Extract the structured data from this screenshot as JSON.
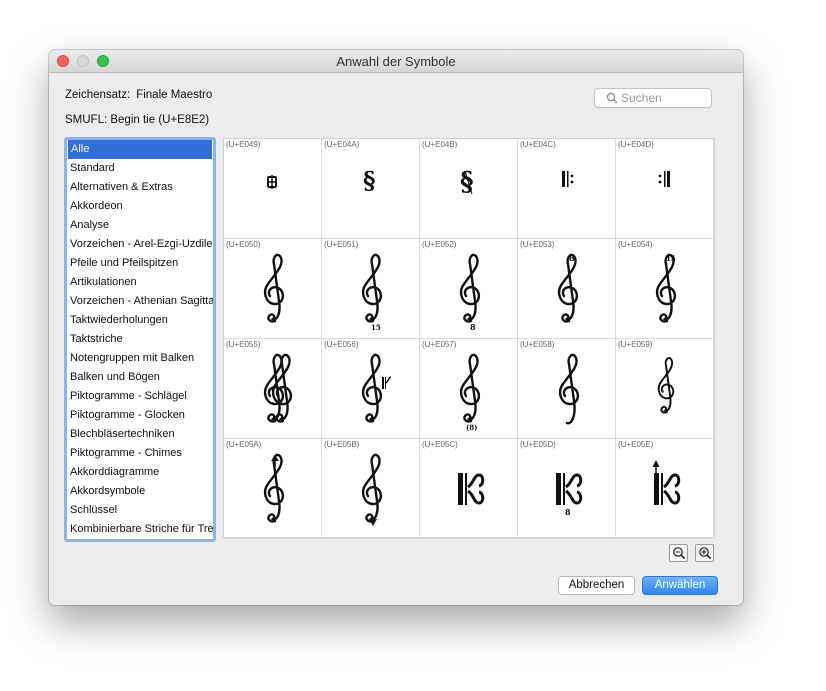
{
  "window": {
    "title": "Anwahl der Symbole"
  },
  "font": {
    "label": "Zeichensatz:",
    "value": "Finale Maestro"
  },
  "smufl_label": "SMUFL: Begin tie (U+E8E2)",
  "search": {
    "placeholder": "Suchen",
    "value": ""
  },
  "categories": [
    "Alle",
    "Standard",
    "Alternativen & Extras",
    "Akkordeon",
    "Analyse",
    "Vorzeichen - Arel-Ezgi-Uzdilek",
    "Pfeile und Pfeilspitzen",
    "Artikulationen",
    "Vorzeichen - Athenian Sagittal",
    "Taktwiederholungen",
    "Taktstriche",
    "Notengruppen mit Balken",
    "Balken und Bögen",
    "Piktogramme - Schlägel",
    "Piktogramme - Glocken",
    "Blechbläsertechniken",
    "Piktogramme - Chimes",
    "Akkorddiagramme",
    "Akkordsymbole",
    "Schlüssel",
    "Kombinierbare Striche für Tremolo"
  ],
  "selected_category": "Alle",
  "symbols": [
    {
      "code": "(U+E049)",
      "icon": "segno-variant-icon"
    },
    {
      "code": "(U+E04A)",
      "icon": "segno-icon"
    },
    {
      "code": "(U+E04B)",
      "icon": "segno-serpent-icon"
    },
    {
      "code": "(U+E04C)",
      "icon": "repeat-left-icon"
    },
    {
      "code": "(U+E04D)",
      "icon": "repeat-right-icon"
    },
    {
      "code": "(U+E050)",
      "icon": "g-clef-icon"
    },
    {
      "code": "(U+E051)",
      "icon": "g-clef-15mb-icon"
    },
    {
      "code": "(U+E052)",
      "icon": "g-clef-8vb-icon"
    },
    {
      "code": "(U+E053)",
      "icon": "g-clef-8va-icon"
    },
    {
      "code": "(U+E054)",
      "icon": "g-clef-15ma-icon"
    },
    {
      "code": "(U+E055)",
      "icon": "g-clef-8vb-old-icon"
    },
    {
      "code": "(U+E056)",
      "icon": "g-clef-8vb-cclef-icon"
    },
    {
      "code": "(U+E057)",
      "icon": "g-clef-8vb-parens-icon"
    },
    {
      "code": "(U+E058)",
      "icon": "g-clef-ligature-icon"
    },
    {
      "code": "(U+E059)",
      "icon": "g-clef-small-icon"
    },
    {
      "code": "(U+E05A)",
      "icon": "g-clef-arrow-up-icon"
    },
    {
      "code": "(U+E05B)",
      "icon": "g-clef-arrow-down-icon"
    },
    {
      "code": "(U+E05C)",
      "icon": "c-clef-icon"
    },
    {
      "code": "(U+E05D)",
      "icon": "c-clef-8vb-icon"
    },
    {
      "code": "(U+E05E)",
      "icon": "c-clef-arrow-up-icon"
    }
  ],
  "buttons": {
    "cancel": "Abbrechen",
    "ok": "Anwählen"
  }
}
